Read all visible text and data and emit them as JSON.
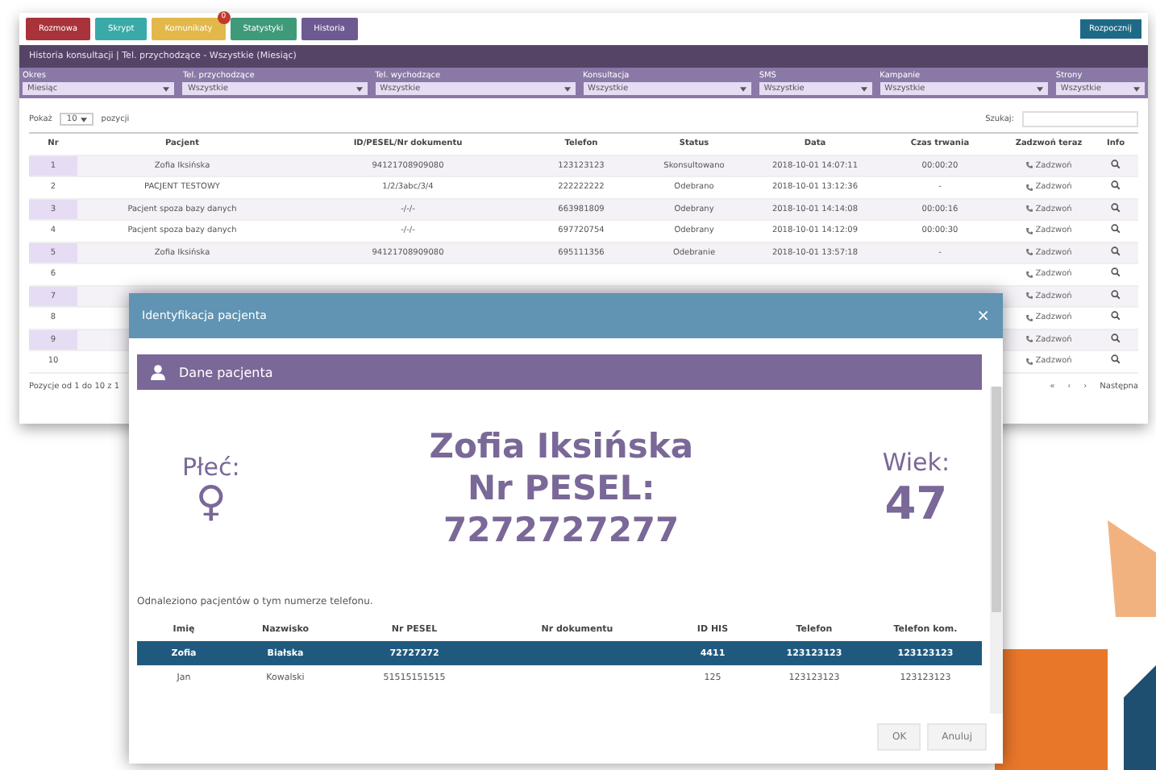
{
  "toolbar": {
    "buttons": [
      {
        "label": "Rozmowa",
        "kind": "red"
      },
      {
        "label": "Skrypt",
        "kind": "teal"
      },
      {
        "label": "Komunikaty",
        "kind": "yellow",
        "badge": "0"
      },
      {
        "label": "Statystyki",
        "kind": "green"
      },
      {
        "label": "Historia",
        "kind": "purple"
      }
    ],
    "right_button": "Rozpocznij"
  },
  "panel": {
    "title": "Historia konsultacji | Tel. przychodzące - Wszystkie (Miesiąc)",
    "filters": [
      {
        "label": "Okres",
        "value": "Miesiąc"
      },
      {
        "label": "Tel. przychodzące",
        "value": "Wszystkie"
      },
      {
        "label": "Tel. wychodzące",
        "value": "Wszystkie"
      },
      {
        "label": "Konsultacja",
        "value": "Wszystkie"
      },
      {
        "label": "SMS",
        "value": "Wszystkie"
      },
      {
        "label": "Kampanie",
        "value": "Wszystkie"
      },
      {
        "label": "Strony",
        "value": "Wszystkie"
      }
    ],
    "show_label": "Pokaż",
    "page_size": "10",
    "entries_label": "pozycji",
    "search_label": "Szukaj:"
  },
  "table": {
    "columns": [
      "Nr",
      "Pacjent",
      "ID/PESEL/Nr dokumentu",
      "Telefon",
      "Status",
      "Data",
      "Czas trwania",
      "Zadzwoń teraz",
      "Info"
    ],
    "rows": [
      {
        "nr": "1",
        "patient": "Zofia Iksińska",
        "id": "94121708909080",
        "phone": "123123123",
        "status": "Skonsultowano",
        "date": "2018-10-01 14:07:11",
        "duration": "00:00:20",
        "call": "Zadzwoń"
      },
      {
        "nr": "2",
        "patient": "PACJENT TESTOWY",
        "id": "1/2/3abc/3/4",
        "phone": "222222222",
        "status": "Odebrano",
        "date": "2018-10-01 13:12:36",
        "duration": "-",
        "call": "Zadzwoń"
      },
      {
        "nr": "3",
        "patient": "Pacjent spoza bazy danych",
        "id": "-/-/-",
        "phone": "663981809",
        "status": "Odebrany",
        "date": "2018-10-01 14:14:08",
        "duration": "00:00:16",
        "call": "Zadzwoń"
      },
      {
        "nr": "4",
        "patient": "Pacjent spoza bazy danych",
        "id": "-/-/-",
        "phone": "697720754",
        "status": "Odebrany",
        "date": "2018-10-01 14:12:09",
        "duration": "00:00:30",
        "call": "Zadzwoń"
      },
      {
        "nr": "5",
        "patient": "Zofia Iksińska",
        "id": "94121708909080",
        "phone": "695111356",
        "status": "Odebranie",
        "date": "2018-10-01 13:57:18",
        "duration": "-",
        "call": "Zadzwoń"
      },
      {
        "nr": "6",
        "call": "Zadzwoń"
      },
      {
        "nr": "7",
        "call": "Zadzwoń"
      },
      {
        "nr": "8",
        "call": "Zadzwoń"
      },
      {
        "nr": "9",
        "call": "Zadzwoń"
      },
      {
        "nr": "10",
        "call": "Zadzwoń"
      }
    ],
    "footer": "Pozycje od 1 do 10 z 1",
    "pagination": [
      "«",
      "‹",
      "›",
      "Następna"
    ]
  },
  "modal": {
    "title": "Identyfikacja pacjenta",
    "close": "×",
    "section": "Dane pacjenta",
    "sex_label": "Płeć:",
    "sex_symbol": "♀",
    "name": "Zofia Iksińska",
    "pesel_label": "Nr PESEL:",
    "pesel": "7272727277",
    "age_label": "Wiek:",
    "age": "47",
    "found_text": "Odnaleziono pacjentów o tym numerze telefonu.",
    "columns": [
      "Imię",
      "Nazwisko",
      "Nr PESEL",
      "Nr dokumentu",
      "ID HIS",
      "Telefon",
      "Telefon kom."
    ],
    "rows": [
      {
        "cells": [
          "Zofia",
          "Białska",
          "72727272",
          "",
          "4411",
          "123123123",
          "123123123"
        ],
        "selected": true
      },
      {
        "cells": [
          "Jan",
          "Kowalski",
          "51515151515",
          "",
          "125",
          "123123123",
          "123123123"
        ],
        "selected": false
      }
    ],
    "buttons": [
      "OK",
      "Anuluj"
    ]
  }
}
